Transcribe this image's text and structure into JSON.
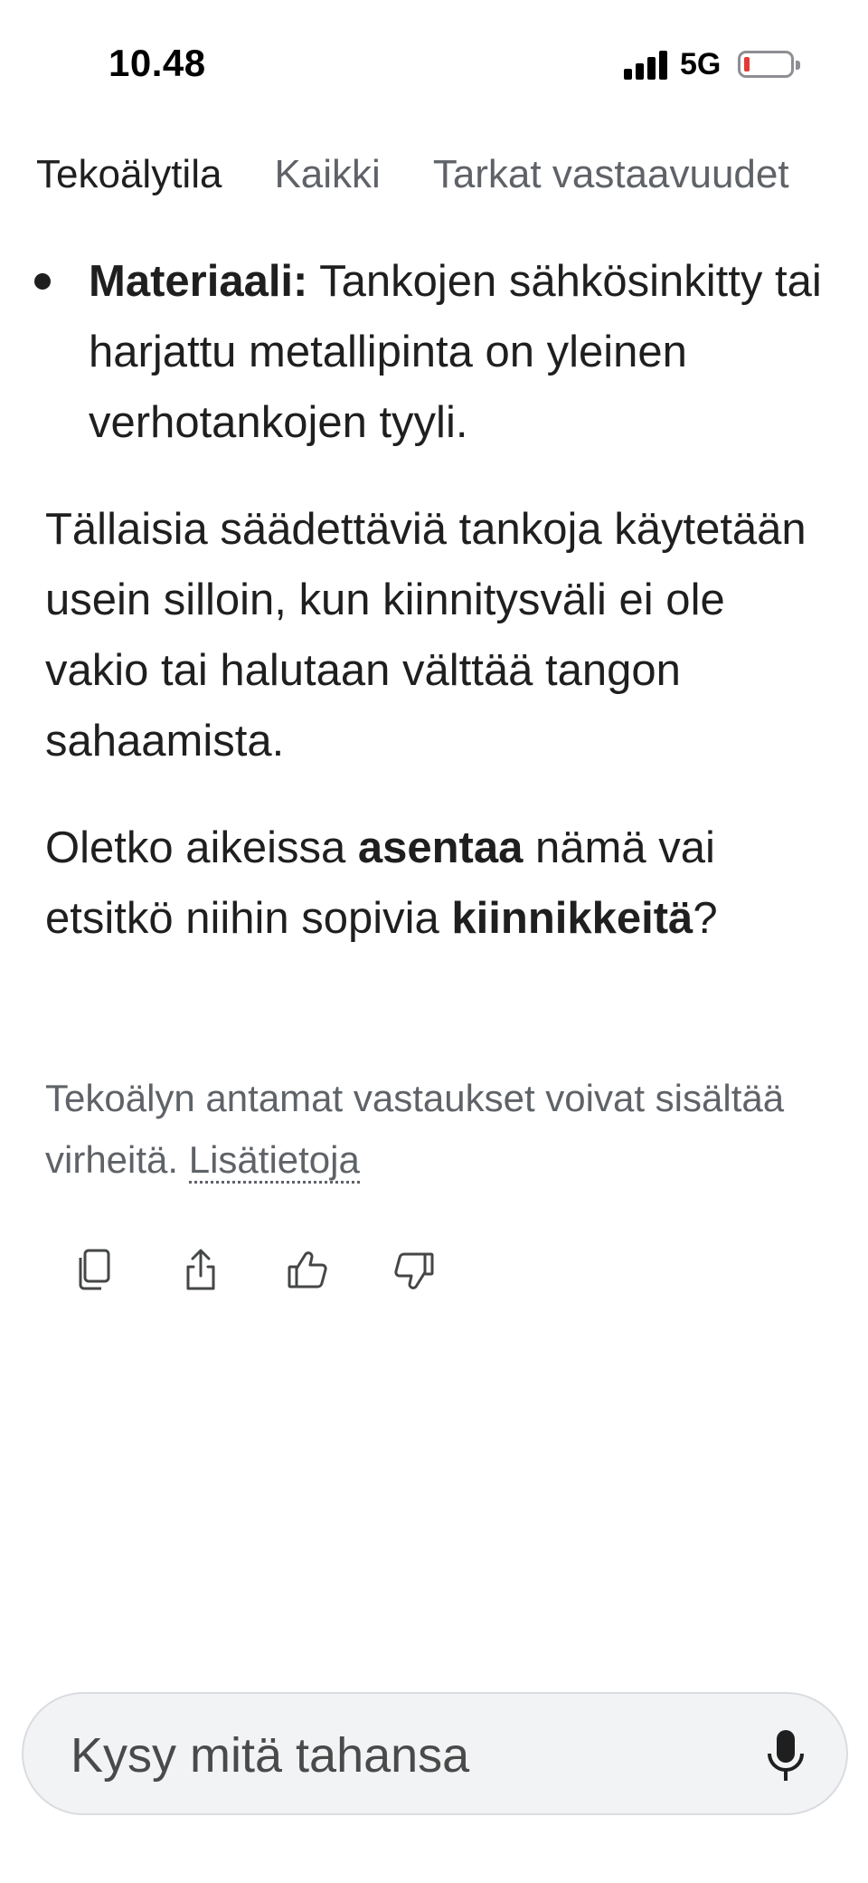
{
  "status_bar": {
    "time": "10.48",
    "network": "5G",
    "icons": [
      "signal-icon",
      "battery-low-icon"
    ],
    "battery_color": "#e53935"
  },
  "tabs": [
    {
      "label": "Tekoälytila",
      "active": true
    },
    {
      "label": "Kaikki",
      "active": false
    },
    {
      "label": "Tarkat vastaavuudet",
      "active": false
    }
  ],
  "content": {
    "bullet": {
      "term": "Materiaali:",
      "text": " Tankojen sähkösinkitty tai harjattu metallipinta on yleinen verhotankojen tyyli."
    },
    "paragraph": "Tällaisia säädettäviä tankoja käytetään usein silloin, kun kiinnitysväli ei ole vakio tai halutaan välttää tangon sahaamista.",
    "question": {
      "part1": "Oletko aikeissa ",
      "bold1": "asentaa",
      "part2": " nämä vai etsitkö niihin sopivia ",
      "bold2": "kiinnikkeitä",
      "part3": "?"
    }
  },
  "disclaimer": {
    "text": "Tekoälyn antamat vastaukset voivat sisältää virheitä. ",
    "link": "Lisätietoja"
  },
  "actions": [
    {
      "name": "copy-icon"
    },
    {
      "name": "share-icon"
    },
    {
      "name": "thumbs-up-icon"
    },
    {
      "name": "thumbs-down-icon"
    }
  ],
  "search": {
    "placeholder": "Kysy mitä tahansa",
    "icon": "microphone-icon"
  }
}
